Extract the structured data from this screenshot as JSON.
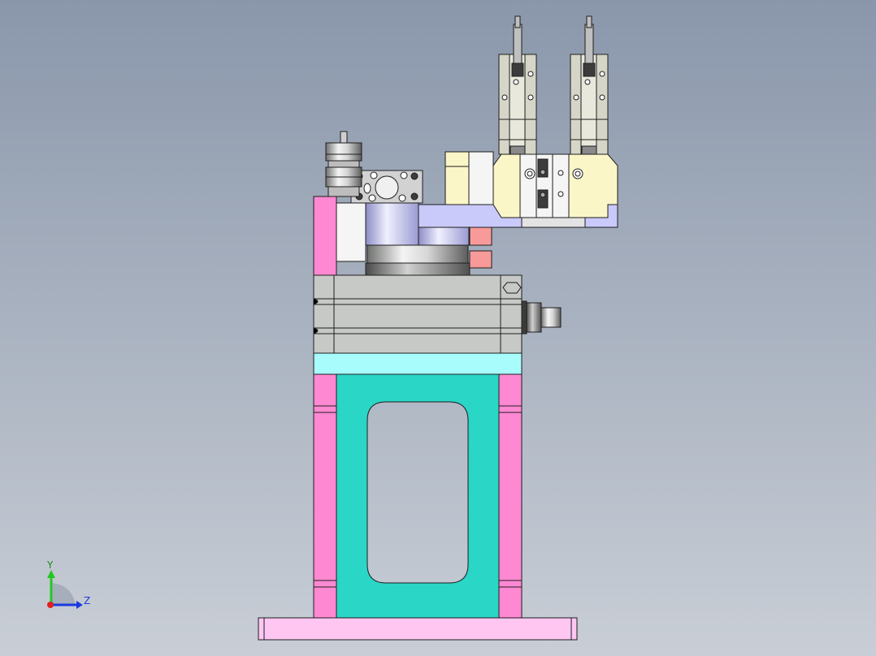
{
  "viewport": {
    "background_top": "#8a97ab",
    "background_bottom": "#c9ced6"
  },
  "triad": {
    "y_label": "Y",
    "z_label": "Z",
    "y_color": "#22c822",
    "z_color": "#1a3ae0",
    "x_color": "#e02020"
  },
  "colors": {
    "base_plate": "#ffc6f2",
    "side_plate": "#ff88d2",
    "frame": "#2ad6c6",
    "cyan_strip": "#a8fcfc",
    "cylinder_body": "#c6c9c6",
    "lavender": "#c9c9fa",
    "yellow": "#fbf6c8",
    "salmon": "#f89a9a",
    "steel": "#a3a6a3",
    "dark": "#3c3c3c"
  }
}
